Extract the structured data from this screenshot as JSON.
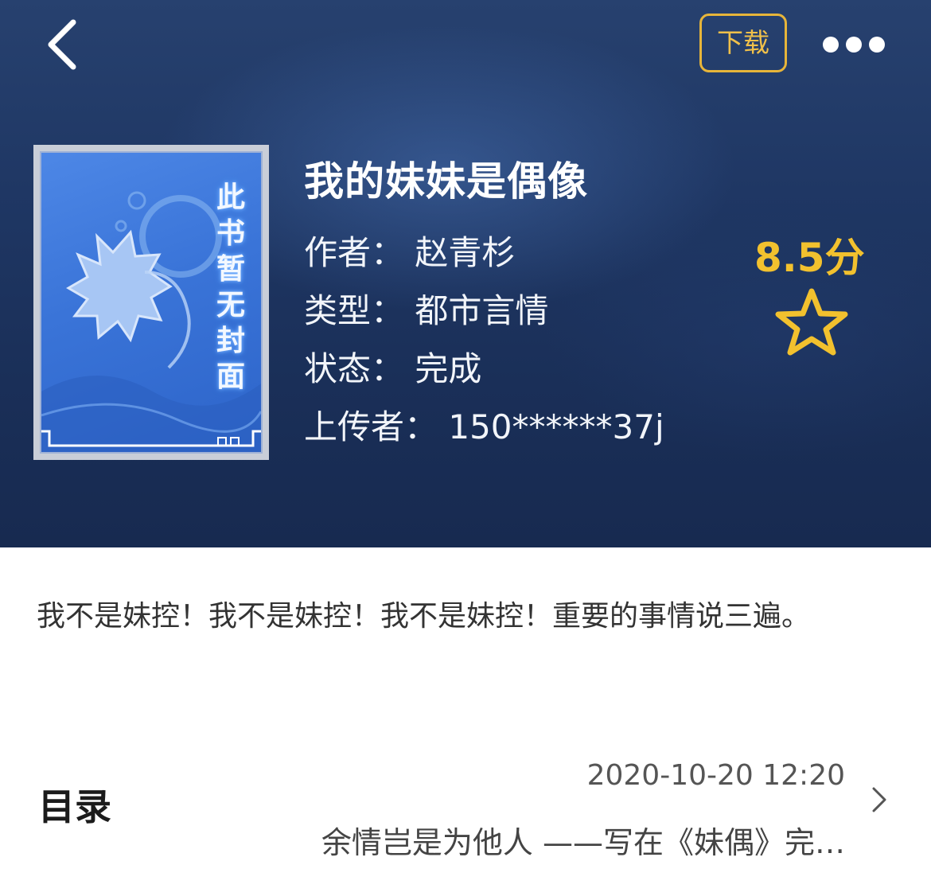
{
  "header": {
    "back_icon": "chevron-left-icon",
    "download_label": "下载",
    "more_icon": "more-dots-icon"
  },
  "book": {
    "cover_text": [
      "此",
      "书",
      "暂",
      "无",
      "封",
      "面"
    ],
    "title": "我的妹妹是偶像",
    "author": "作者：  赵青杉",
    "genre": "类型：  都市言情",
    "status": "状态：  完成",
    "uploader": "上传者：  150******37j",
    "rating": "8.5分",
    "star_icon": "star-outline-icon"
  },
  "description": "我不是妹控！我不是妹控！我不是妹控！重要的事情说三遍。",
  "catalog": {
    "title": "目录",
    "updated": "2020-10-20 12:20",
    "latest_chapter": "余情岂是为他人 ——写在《妹偶》完…"
  },
  "colors": {
    "accent": "#f2c12e",
    "hero_bg": "#1f3764"
  }
}
